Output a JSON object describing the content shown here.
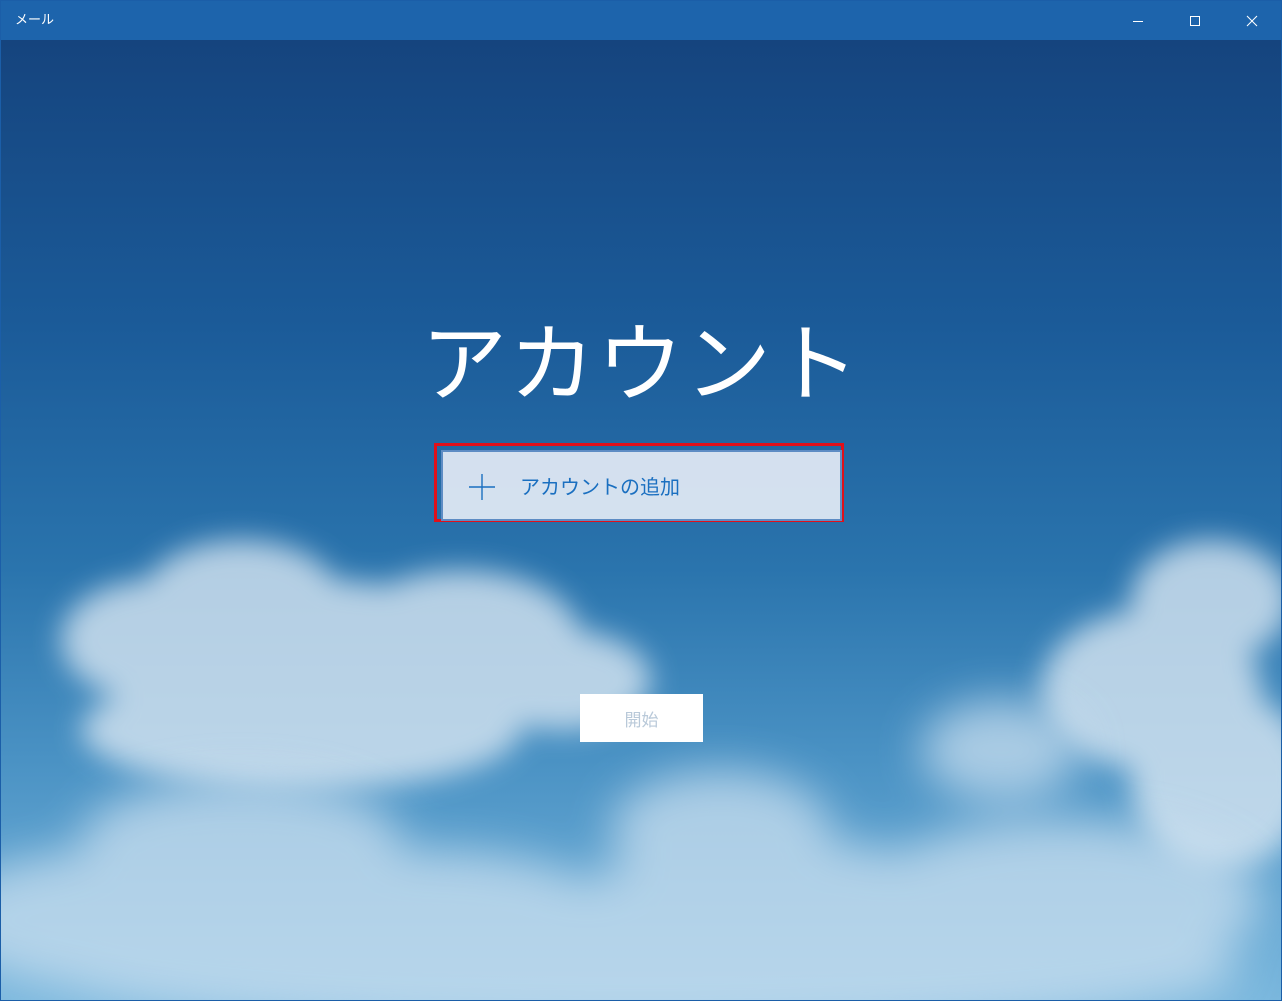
{
  "window": {
    "title": "メール",
    "controls": {
      "minimize_icon": "minimize-icon",
      "maximize_icon": "maximize-icon",
      "close_icon": "close-icon"
    }
  },
  "main": {
    "heading": "アカウント",
    "add_account": {
      "label": "アカウントの追加",
      "icon": "plus-icon"
    },
    "start_button": {
      "label": "開始",
      "enabled": false
    }
  },
  "colors": {
    "titlebar": "#1d64ac",
    "accent_text": "#1a6fc0",
    "highlight_border": "#e0101a",
    "disabled_text": "#b9c9d9"
  }
}
